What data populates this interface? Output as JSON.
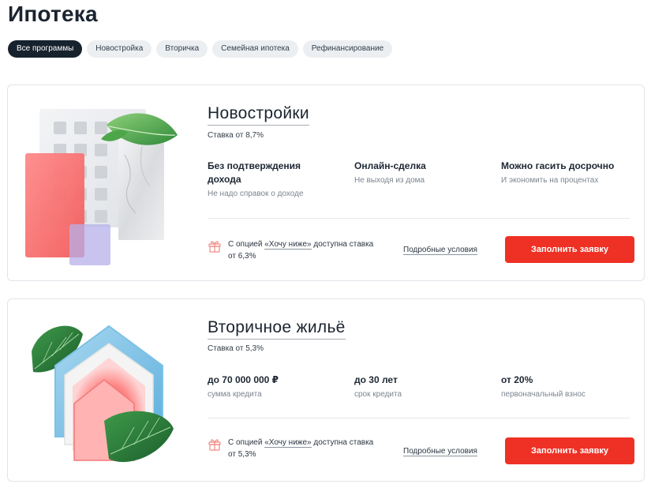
{
  "page": {
    "title": "Ипотека"
  },
  "chips": [
    {
      "label": "Все программы",
      "active": true
    },
    {
      "label": "Новостройка"
    },
    {
      "label": "Вторичка"
    },
    {
      "label": "Семейная ипотека"
    },
    {
      "label": "Рефинансирование"
    }
  ],
  "cards": [
    {
      "title": "Новостройки",
      "rate": "Ставка от 8,7%",
      "features": [
        {
          "title": "Без подтверждения дохода",
          "sub": "Не надо справок о доходе"
        },
        {
          "title": "Онлайн-сделка",
          "sub": "Не выходя из дома"
        },
        {
          "title": "Можно гасить досрочно",
          "sub": "И экономить на процентах"
        }
      ],
      "gift": {
        "prefix": "С опцией ",
        "link": "«Хочу ниже»",
        "suffix": " доступна ставка от 6,3%",
        "icon": "gift-icon"
      },
      "details": "Подробные условия",
      "apply": "Заполнить заявку"
    },
    {
      "title": "Вторичное жильё",
      "rate": "Ставка от 5,3%",
      "features": [
        {
          "title": "до 70 000 000 ₽",
          "sub": "сумма кредита"
        },
        {
          "title": "до 30 лет",
          "sub": "срок кредита"
        },
        {
          "title": "от 20%",
          "sub": "первоначальный взнос"
        }
      ],
      "gift": {
        "prefix": "С опцией ",
        "link": "«Хочу ниже»",
        "suffix": " доступна ставка от 5,3%",
        "icon": "gift-icon"
      },
      "details": "Подробные условия",
      "apply": "Заполнить заявку"
    }
  ],
  "colors": {
    "accent": "#ee3124",
    "dark": "#17222f",
    "chip_bg": "#eceff2"
  }
}
